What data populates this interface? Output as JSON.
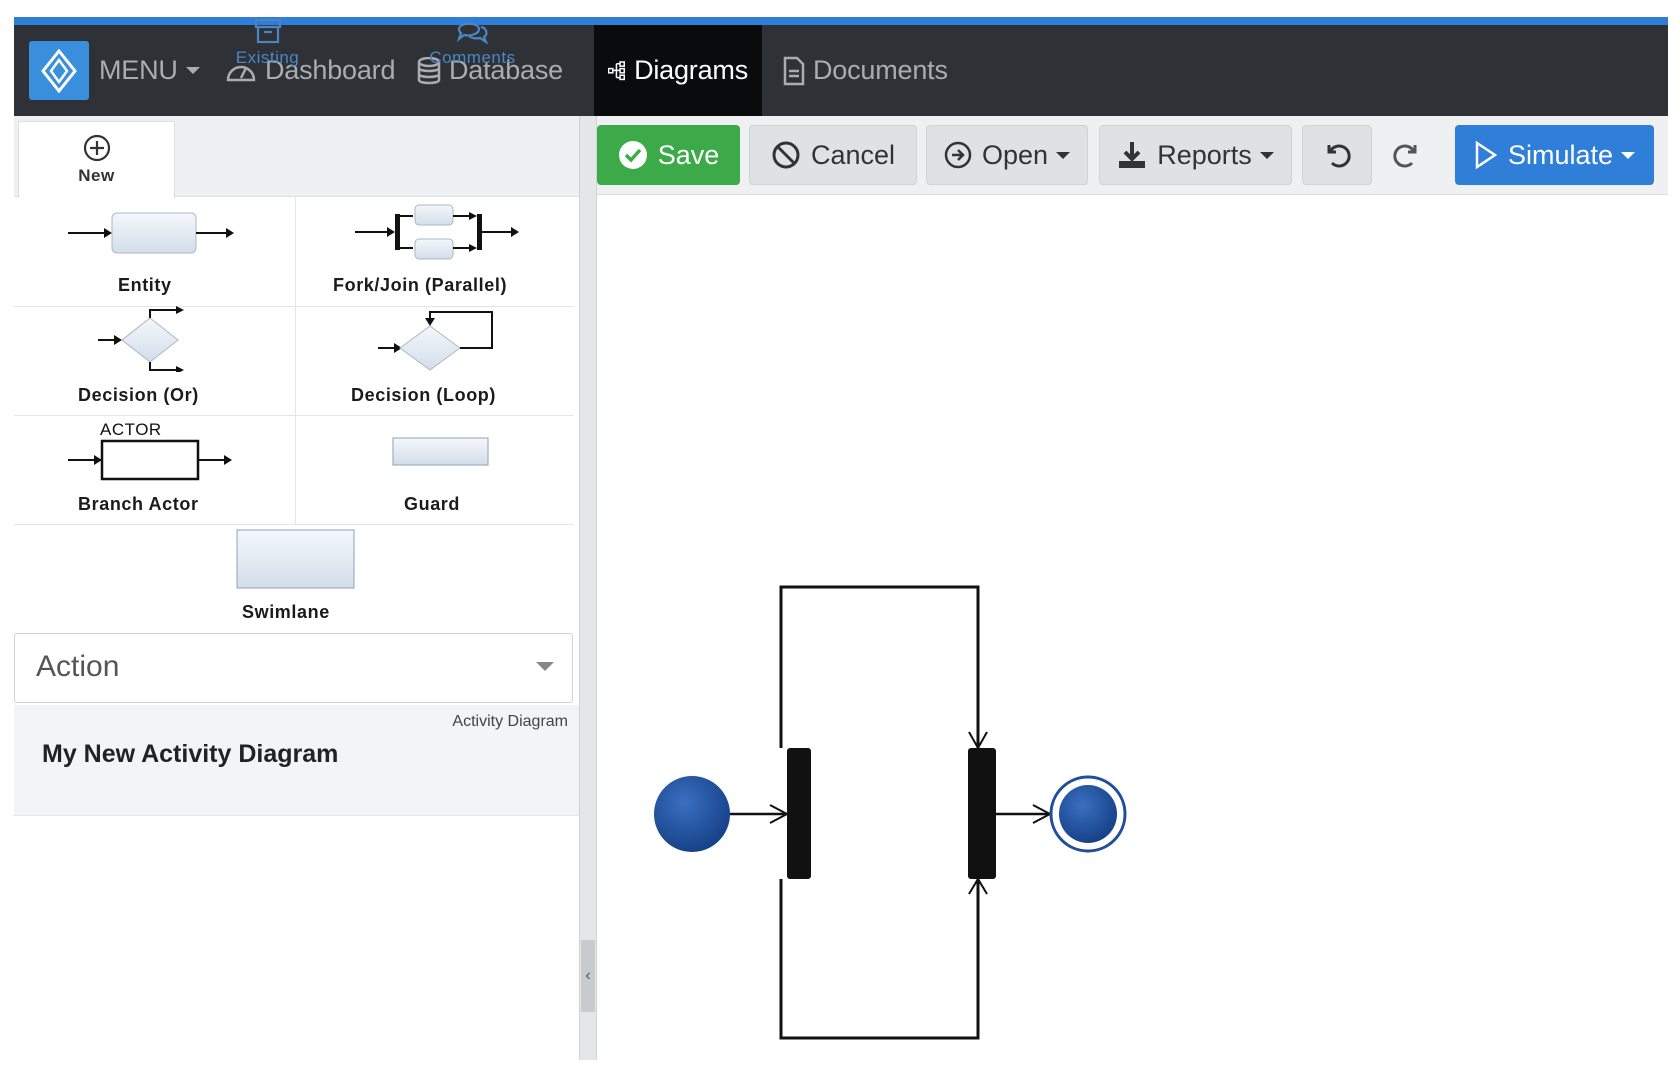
{
  "nav": {
    "menu": "MENU",
    "dashboard": "Dashboard",
    "database": "Database",
    "diagrams": "Diagrams",
    "documents": "Documents"
  },
  "tabs": {
    "new": "New",
    "existing": "Existing",
    "comments": "Comments"
  },
  "shapes": {
    "entity": "Entity",
    "fork_join": "Fork/Join (Parallel)",
    "decision_or": "Decision (Or)",
    "decision_loop": "Decision (Loop)",
    "branch_actor": "Branch Actor",
    "actor_caption": "ACTOR",
    "guard": "Guard",
    "swimlane": "Swimlane"
  },
  "action_select": {
    "value": "Action"
  },
  "diagram": {
    "type": "Activity Diagram",
    "name": "My New Activity Diagram"
  },
  "toolbar": {
    "save": "Save",
    "cancel": "Cancel",
    "open": "Open",
    "reports": "Reports",
    "simulate": "Simulate"
  },
  "colors": {
    "accent": "#2f7ed8",
    "nav_bg": "#2e3236",
    "save_green": "#3daa4a",
    "node_blue": "#1f4f9a"
  },
  "icons": [
    "logo-icon",
    "dashboard-icon",
    "database-icon",
    "diagrams-icon",
    "documents-icon",
    "plus-circle-icon",
    "archive-icon",
    "comments-icon",
    "check-circle-icon",
    "ban-icon",
    "open-arrow-icon",
    "download-icon",
    "undo-icon",
    "redo-icon",
    "play-icon",
    "chevron-left-icon"
  ]
}
